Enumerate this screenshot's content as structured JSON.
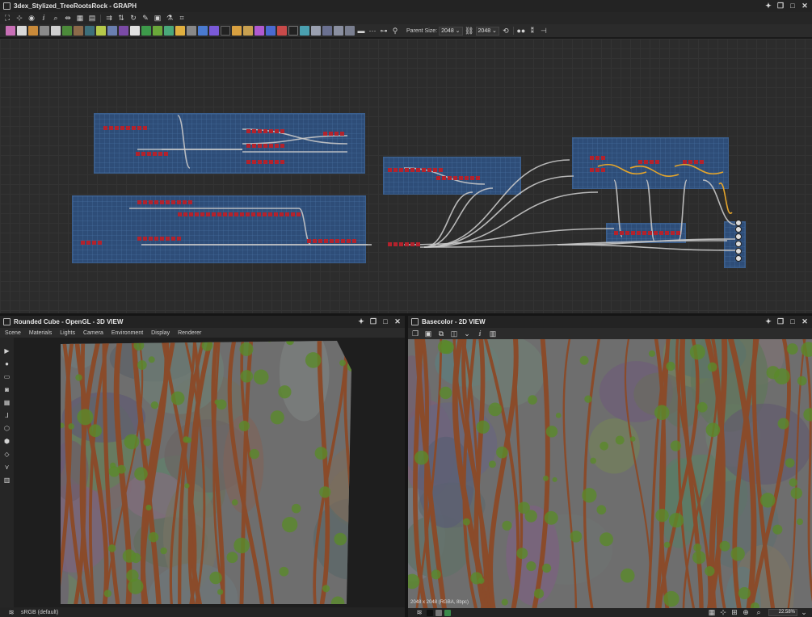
{
  "graph": {
    "title": "3dex_Stylized_TreeRootsRock - GRAPH",
    "parent_size_label": "Parent Size:",
    "parent_size_value": "2048",
    "output_size_value": "2048",
    "colors": {
      "frame": "#2e4d78",
      "node": "#b3222c",
      "link": "#c8c8c8",
      "link_highlight": "#e5a52b"
    }
  },
  "view3d": {
    "title": "Rounded Cube - OpenGL - 3D VIEW",
    "menu": [
      "Scene",
      "Materials",
      "Lights",
      "Camera",
      "Environment",
      "Display",
      "Renderer"
    ],
    "colorspace": "sRGB (default)"
  },
  "view2d": {
    "title": "Basecolor - 2D VIEW",
    "image_info": "2048 x 2048 (RGBA, 8bpc)",
    "zoom": "22.58%"
  },
  "texture_colors": {
    "rock": "#6e6e6e",
    "root": "#8a4b2a",
    "moss": "#5a8a2a"
  }
}
